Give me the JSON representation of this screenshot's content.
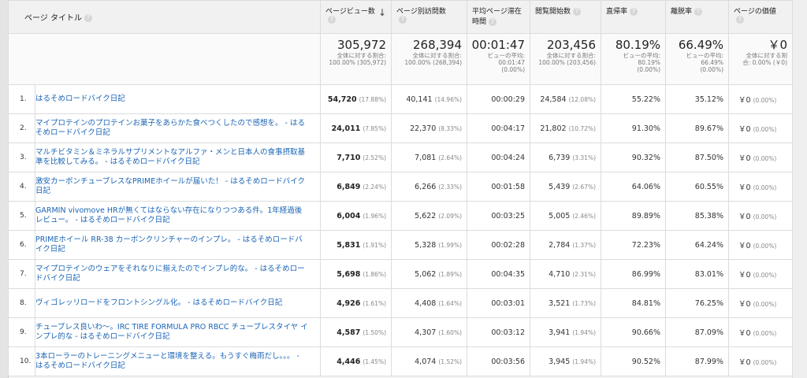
{
  "headers": {
    "page_title": "ページ タイトル",
    "pageviews": "ページビュー数",
    "unique_pageviews": "ページ別訪問数",
    "avg_time_l1": "平均ページ滞在",
    "avg_time_l2": "時間",
    "entrances": "閲覧開始数",
    "bounce_rate": "直帰率",
    "exit_rate": "離脱率",
    "page_value": "ページの価値",
    "help_icon": "?",
    "sort_icon": "↓"
  },
  "totals": {
    "pageviews": {
      "value": "305,972",
      "sub1": "全体に対する割合:",
      "sub2": "100.00% (305,972)"
    },
    "unique_pageviews": {
      "value": "268,394",
      "sub1": "全体に対する割合:",
      "sub2": "100.00% (268,394)"
    },
    "avg_time": {
      "value": "00:01:47",
      "sub1": "ビューの平均:",
      "sub2": "00:01:47",
      "sub3": "(0.00%)"
    },
    "entrances": {
      "value": "203,456",
      "sub1": "全体に対する割合:",
      "sub2": "100.00% (203,456)"
    },
    "bounce_rate": {
      "value": "80.19%",
      "sub1": "ビューの平均:",
      "sub2": "80.19%",
      "sub3": "(0.00%)"
    },
    "exit_rate": {
      "value": "66.49%",
      "sub1": "ビューの平均:",
      "sub2": "66.49%",
      "sub3": "(0.00%)"
    },
    "page_value": {
      "value": "￥0",
      "sub1": "全体に対する割",
      "sub2": "合: 0.00% (￥0)"
    }
  },
  "rows": [
    {
      "num": "1.",
      "title": "はるそめロードバイク日記",
      "pv": "54,720",
      "pv_pct": "(17.88%)",
      "upv": "40,141",
      "upv_pct": "(14.96%)",
      "time": "00:00:29",
      "ent": "24,584",
      "ent_pct": "(12.08%)",
      "bounce": "55.22%",
      "exit": "35.12%",
      "value": "￥0",
      "value_pct": "(0.00%)"
    },
    {
      "num": "2.",
      "title": "マイプロテインのプロテインお菓子をあらかた食べつくしたので感想を。 - はるそめロードバイク日記",
      "pv": "24,011",
      "pv_pct": "(7.85%)",
      "upv": "22,370",
      "upv_pct": "(8.33%)",
      "time": "00:04:17",
      "ent": "21,802",
      "ent_pct": "(10.72%)",
      "bounce": "91.30%",
      "exit": "89.67%",
      "value": "￥0",
      "value_pct": "(0.00%)"
    },
    {
      "num": "3.",
      "title": "マルチビタミン＆ミネラルサプリメントなアルファ・メンと日本人の食事摂取基準を比較してみる。 - はるそめロードバイク日記",
      "pv": "7,710",
      "pv_pct": "(2.52%)",
      "upv": "7,081",
      "upv_pct": "(2.64%)",
      "time": "00:04:24",
      "ent": "6,739",
      "ent_pct": "(3.31%)",
      "bounce": "90.32%",
      "exit": "87.50%",
      "value": "￥0",
      "value_pct": "(0.00%)"
    },
    {
      "num": "4.",
      "title": "激安カーボンチューブレスなPRIMEホイールが届いた！ - はるそめロードバイク日記",
      "pv": "6,849",
      "pv_pct": "(2.24%)",
      "upv": "6,266",
      "upv_pct": "(2.33%)",
      "time": "00:01:58",
      "ent": "5,439",
      "ent_pct": "(2.67%)",
      "bounce": "64.06%",
      "exit": "60.55%",
      "value": "￥0",
      "value_pct": "(0.00%)"
    },
    {
      "num": "5.",
      "title": "GARMIN vivomove HRが無くてはならない存在になりつつある件。1年経過後レビュー。 - はるそめロードバイク日記",
      "pv": "6,004",
      "pv_pct": "(1.96%)",
      "upv": "5,622",
      "upv_pct": "(2.09%)",
      "time": "00:03:25",
      "ent": "5,005",
      "ent_pct": "(2.46%)",
      "bounce": "89.89%",
      "exit": "85.38%",
      "value": "￥0",
      "value_pct": "(0.00%)"
    },
    {
      "num": "6.",
      "title": "PRIMEホイール RR-38 カーボンクリンチャーのインプレ。 - はるそめロードバイク日記",
      "pv": "5,831",
      "pv_pct": "(1.91%)",
      "upv": "5,328",
      "upv_pct": "(1.99%)",
      "time": "00:02:28",
      "ent": "2,784",
      "ent_pct": "(1.37%)",
      "bounce": "72.23%",
      "exit": "64.24%",
      "value": "￥0",
      "value_pct": "(0.00%)"
    },
    {
      "num": "7.",
      "title": "マイプロテインのウェアをそれなりに揃えたのでインプレ的な。 - はるそめロードバイク日記",
      "pv": "5,698",
      "pv_pct": "(1.86%)",
      "upv": "5,062",
      "upv_pct": "(1.89%)",
      "time": "00:04:35",
      "ent": "4,710",
      "ent_pct": "(2.31%)",
      "bounce": "86.99%",
      "exit": "83.01%",
      "value": "￥0",
      "value_pct": "(0.00%)"
    },
    {
      "num": "8.",
      "title": "ヴィゴレッリロードをフロントシングル化。 - はるそめロードバイク日記",
      "pv": "4,926",
      "pv_pct": "(1.61%)",
      "upv": "4,408",
      "upv_pct": "(1.64%)",
      "time": "00:03:01",
      "ent": "3,521",
      "ent_pct": "(1.73%)",
      "bounce": "84.81%",
      "exit": "76.25%",
      "value": "￥0",
      "value_pct": "(0.00%)"
    },
    {
      "num": "9.",
      "title": "チューブレス良いわ〜。IRC TIRE FORMULA PRO RBCC チューブレスタイヤ インプレ的な - はるそめロードバイク日記",
      "pv": "4,587",
      "pv_pct": "(1.50%)",
      "upv": "4,307",
      "upv_pct": "(1.60%)",
      "time": "00:03:12",
      "ent": "3,941",
      "ent_pct": "(1.94%)",
      "bounce": "90.66%",
      "exit": "87.09%",
      "value": "￥0",
      "value_pct": "(0.00%)"
    },
    {
      "num": "10.",
      "title": "3本ローラーのトレーニングメニューと環境を整える。もうすぐ梅雨だし。。。 - はるそめロードバイク日記",
      "pv": "4,446",
      "pv_pct": "(1.45%)",
      "upv": "4,074",
      "upv_pct": "(1.52%)",
      "time": "00:03:56",
      "ent": "3,945",
      "ent_pct": "(1.94%)",
      "bounce": "90.52%",
      "exit": "87.99%",
      "value": "￥0",
      "value_pct": "(0.00%)"
    }
  ]
}
